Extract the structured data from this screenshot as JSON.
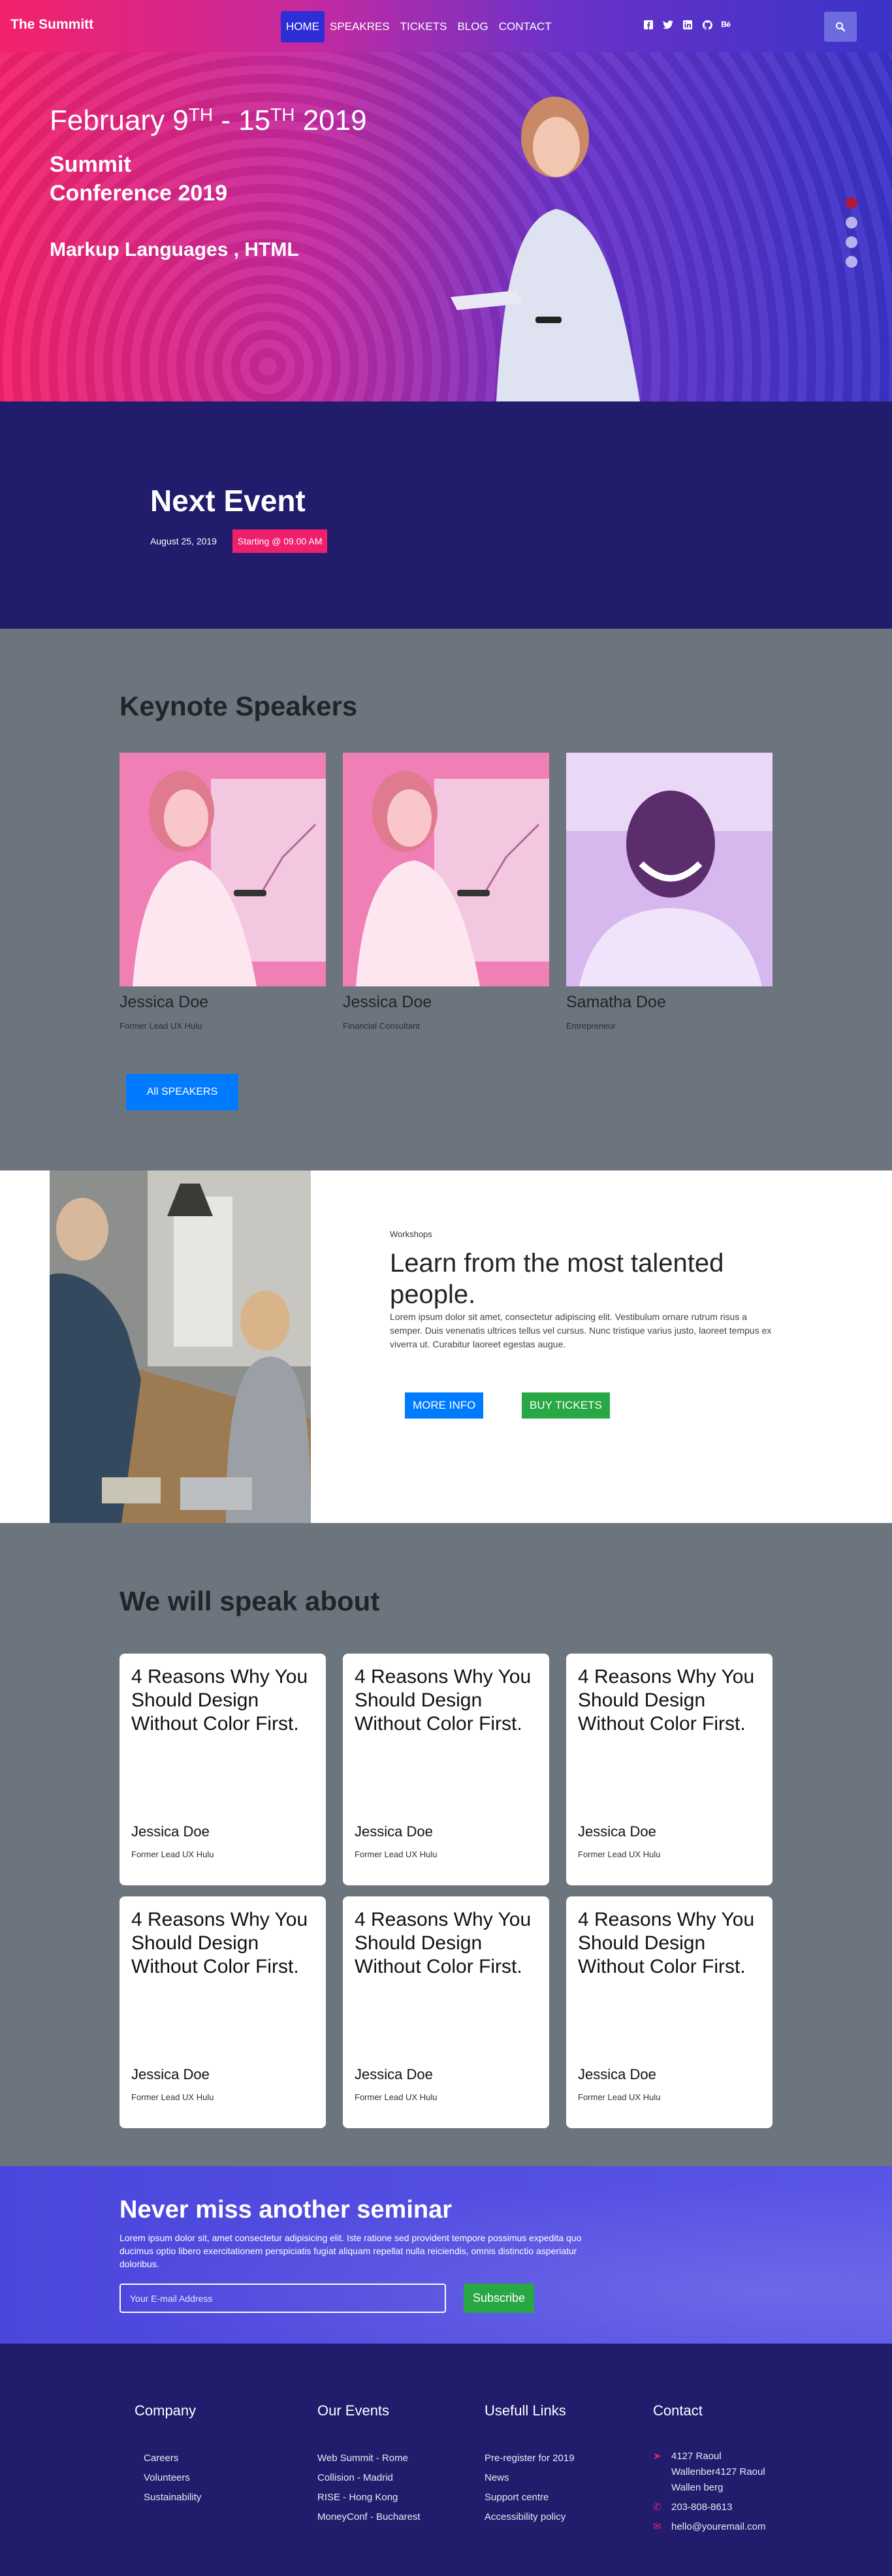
{
  "navbar": {
    "brand": "The Summitt",
    "links": [
      "HOME",
      "SPEAKRES",
      "TICKETS",
      "BLOG",
      "CONTACT"
    ],
    "active_link": "HOME",
    "social_icons": [
      "facebook-icon",
      "twitter-icon",
      "linkedin-icon",
      "github-icon",
      "behance-icon"
    ],
    "colors": {
      "active_bg": "#2e2ed6",
      "search_bg": "#6c6ce0"
    }
  },
  "hero": {
    "date_part1": "February 9",
    "date_sup1": "TH",
    "date_part2": " - 15",
    "date_sup2": "TH",
    "date_part3": " 2019",
    "title": "Summit Conference 2019",
    "subtitle": "Markup Languages , HTML",
    "slides": 4,
    "active_slide": 1,
    "colors": {
      "gradient_start": "#f3226a",
      "gradient_end": "#3a33c8"
    }
  },
  "next_event": {
    "heading": "Next Event",
    "date": "August 25, 2019",
    "badge": "Starting @ 09.00 AM",
    "colors": {
      "bg": "#211c6c",
      "badge": "#ee1f6b"
    }
  },
  "keynote": {
    "heading": "Keynote Speakers",
    "speakers": [
      {
        "name": "Jessica Doe",
        "role": "Former Lead UX Hulu"
      },
      {
        "name": "Jessica Doe",
        "role": "Financial Consultant"
      },
      {
        "name": "Samatha Doe",
        "role": "Entrepreneur"
      }
    ],
    "all_button": "All SPEAKERS"
  },
  "workshops": {
    "label": "Workshops",
    "title": "Learn from the most talented people.",
    "text": "Lorem ipsum dolor sit amet, consectetur adipiscing elit. Vestibulum ornare rutrum risus a semper. Duis venenatis ultrices tellus vel cursus. Nunc tristique varius justo, laoreet tempus ex viverra ut. Curabitur laoreet egestas augue.",
    "more_button": "MORE INFO",
    "buy_button": "BUY TICKETS"
  },
  "speak": {
    "heading": "We will speak about",
    "cards": [
      {
        "title": "4 Reasons Why You Should Design Without Color First.",
        "name": "Jessica Doe",
        "role": "Former Lead UX Hulu"
      },
      {
        "title": "4 Reasons Why You Should Design Without Color First.",
        "name": "Jessica Doe",
        "role": "Former Lead UX Hulu"
      },
      {
        "title": "4 Reasons Why You Should Design Without Color First.",
        "name": "Jessica Doe",
        "role": "Former Lead UX Hulu"
      },
      {
        "title": "4 Reasons Why You Should Design Without Color First.",
        "name": "Jessica Doe",
        "role": "Former Lead UX Hulu"
      },
      {
        "title": "4 Reasons Why You Should Design Without Color First.",
        "name": "Jessica Doe",
        "role": "Former Lead UX Hulu"
      },
      {
        "title": "4 Reasons Why You Should Design Without Color First.",
        "name": "Jessica Doe",
        "role": "Former Lead UX Hulu"
      }
    ]
  },
  "newsletter": {
    "heading": "Never miss another seminar",
    "text": "Lorem ipsum dolor sit, amet consectetur adipisicing elit. Iste ratione sed provident tempore possimus expedita quo ducimus optio libero exercitationem perspiciatis fugiat aliquam repellat nulla reiciendis, omnis distinctio asperiatur doloribus.",
    "email_placeholder": "Your E-mail Address",
    "subscribe": "Subscribe"
  },
  "footer": {
    "company": {
      "heading": "Company",
      "items": [
        "Careers",
        "Volunteers",
        "Sustainability"
      ]
    },
    "events": {
      "heading": "Our Events",
      "items": [
        "Web Summit - Rome",
        "Collision - Madrid",
        "RISE - Hong Kong",
        "MoneyConf - Bucharest"
      ]
    },
    "links": {
      "heading": "Usefull Links",
      "items": [
        "Pre-register for 2019",
        "News",
        "Support centre",
        "Accessibility policy"
      ]
    },
    "contact": {
      "heading": "Contact",
      "address": "4127 Raoul Wallenber4127 Raoul Wallen berg",
      "phone": "203-808-8613",
      "email": "hello@youremail.com"
    }
  }
}
